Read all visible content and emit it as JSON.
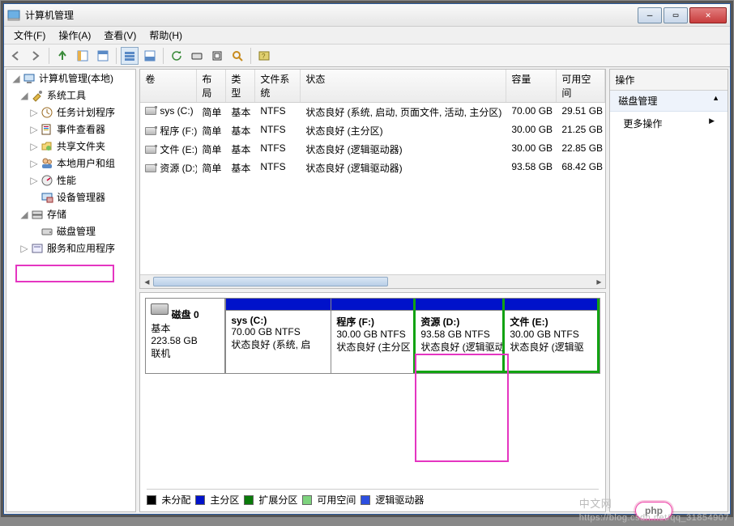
{
  "window": {
    "title": "计算机管理"
  },
  "menu": {
    "file": "文件(F)",
    "action": "操作(A)",
    "view": "查看(V)",
    "help": "帮助(H)"
  },
  "tree": {
    "root": "计算机管理(本地)",
    "sys_tools": "系统工具",
    "task_scheduler": "任务计划程序",
    "event_viewer": "事件查看器",
    "shared_folders": "共享文件夹",
    "local_users": "本地用户和组",
    "performance": "性能",
    "device_manager": "设备管理器",
    "storage": "存储",
    "disk_mgmt": "磁盘管理",
    "services": "服务和应用程序"
  },
  "columns": {
    "volume": "卷",
    "layout": "布局",
    "type": "类型",
    "fs": "文件系统",
    "status": "状态",
    "capacity": "容量",
    "free": "可用空间"
  },
  "volumes": [
    {
      "name": "sys (C:)",
      "layout": "简单",
      "type": "基本",
      "fs": "NTFS",
      "status": "状态良好 (系统, 启动, 页面文件, 活动, 主分区)",
      "capacity": "70.00 GB",
      "free": "29.51 GB"
    },
    {
      "name": "程序 (F:)",
      "layout": "简单",
      "type": "基本",
      "fs": "NTFS",
      "status": "状态良好 (主分区)",
      "capacity": "30.00 GB",
      "free": "21.25 GB"
    },
    {
      "name": "文件 (E:)",
      "layout": "简单",
      "type": "基本",
      "fs": "NTFS",
      "status": "状态良好 (逻辑驱动器)",
      "capacity": "30.00 GB",
      "free": "22.85 GB"
    },
    {
      "name": "资源 (D:)",
      "layout": "简单",
      "type": "基本",
      "fs": "NTFS",
      "status": "状态良好 (逻辑驱动器)",
      "capacity": "93.58 GB",
      "free": "68.42 GB"
    }
  ],
  "disk": {
    "label": "磁盘 0",
    "type": "基本",
    "size": "223.58 GB",
    "status": "联机",
    "parts": [
      {
        "title": "sys  (C:)",
        "sub": "70.00 GB NTFS",
        "detail": "状态良好 (系统, 启",
        "header": "blue"
      },
      {
        "title": "程序  (F:)",
        "sub": "30.00 GB NTFS",
        "detail": "状态良好 (主分区",
        "header": "blue"
      },
      {
        "title": "资源  (D:)",
        "sub": "93.58 GB NTFS",
        "detail": "状态良好 (逻辑驱动",
        "header": "blue-green"
      },
      {
        "title": "文件  (E:)",
        "sub": "30.00 GB NTFS",
        "detail": "状态良好 (逻辑驱",
        "header": "blue-green"
      }
    ]
  },
  "legend": {
    "unalloc": "未分配",
    "primary": "主分区",
    "extended": "扩展分区",
    "free": "可用空间",
    "logical": "逻辑驱动器"
  },
  "actions": {
    "header": "操作",
    "section": "磁盘管理",
    "more": "更多操作"
  },
  "watermark": {
    "php": "php",
    "cn": "中文网",
    "url": "https://blog.csdn.net/qq_31854907"
  }
}
